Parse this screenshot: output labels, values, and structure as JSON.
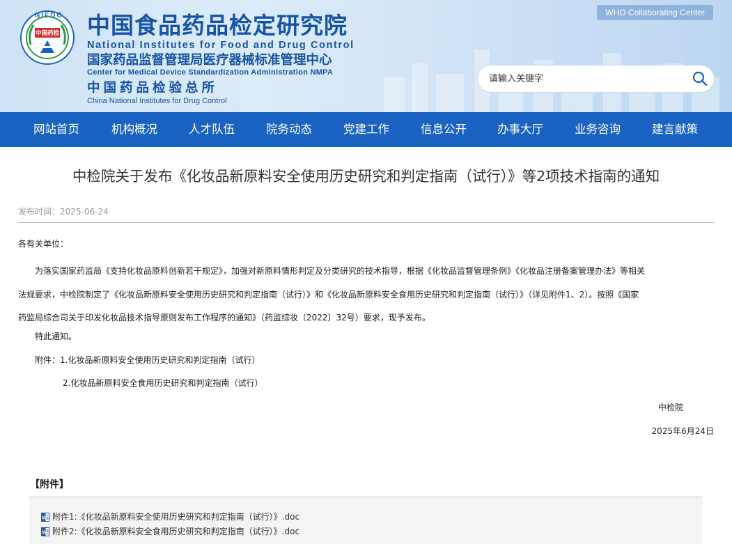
{
  "header": {
    "logo_text_top": "NIFDC",
    "logo_text_center": "中国药检",
    "name_cn": "中国食品药品检定研究院",
    "name_en": "National Institutes for Food and Drug Control",
    "sub_cn": "国家药品监督管理局医疗器械标准管理中心",
    "sub_en": "Center for Medical Device Standardization Administration NMPA",
    "third_cn": "中国药品检验总所",
    "third_en": "China National Institutes for Drug Control",
    "who_badge": "WHO Collaborating Center",
    "search_placeholder": "请输入关键字"
  },
  "nav": {
    "items": [
      {
        "label": "网站首页"
      },
      {
        "label": "机构概况"
      },
      {
        "label": "人才队伍"
      },
      {
        "label": "院务动态"
      },
      {
        "label": "党建工作"
      },
      {
        "label": "信息公开"
      },
      {
        "label": "办事大厅"
      },
      {
        "label": "业务咨询"
      },
      {
        "label": "建言献策"
      }
    ]
  },
  "article": {
    "title": "中检院关于发布《化妆品新原料安全使用历史研究和判定指南（试行）》等2项技术指南的通知",
    "publish_label": "发布时间：",
    "publish_date": "2025-06-24",
    "salutation": "各有关单位：",
    "body_lines": [
      "为落实国家药监局《支持化妆品原料创新若干规定》，加强对新原料情形判定及分类研究的技术指导，根据《化妆品监督管理条例》《化妆品注册备案管理办法》等相关",
      "法规要求，中检院制定了《化妆品新原料安全使用历史研究和判定指南（试行）》和《化妆品新原料安全食用历史研究和判定指南（试行）》（详见附件1、2）。按照《国家",
      "药监局综合司关于印发化妆品技术指导原则发布工作程序的通知》（药监综妆〔2022〕32号）要求，现予发布。"
    ],
    "special_notice": "特此通知。",
    "attachment_line1": "附件：1.化妆品新原料安全使用历史研究和判定指南（试行）",
    "attachment_line2": "2.化妆品新原料安全食用历史研究和判定指南（试行）",
    "signature": "中检院",
    "sign_date": "2025年6月24日"
  },
  "attachments": {
    "heading": "【附件】",
    "files": [
      {
        "label": "附件1:《化妆品新原料安全使用历史研究和判定指南（试行）》.doc"
      },
      {
        "label": "附件2:《化妆品新原料安全食用历史研究和判定指南（试行）》.doc"
      }
    ]
  }
}
